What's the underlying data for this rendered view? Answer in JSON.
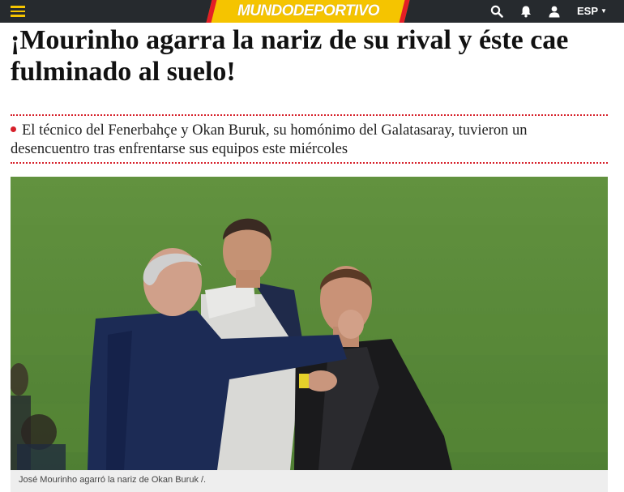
{
  "header": {
    "logo": {
      "part1": "MUNDO",
      "part2": "DEPORTIVO"
    },
    "language": "ESP",
    "icons": [
      "menu-icon",
      "search-icon",
      "bell-icon",
      "user-icon",
      "chevron-down-icon"
    ]
  },
  "article": {
    "headline": "¡Mourinho agarra la nariz de su rival y éste cae fulminado al suelo!",
    "subtitle": "El técnico del Fenerbahçe y Okan Buruk, su homónimo del Galatasaray, tuvieron un desencuentro tras enfrentarse sus equipos este miércoles",
    "photo_caption": "José Mourinho agarró la nariz de Okan Buruk /."
  },
  "colors": {
    "topbar": "#262a2e",
    "logo_yellow": "#f5c400",
    "accent_red": "#d6202a",
    "pitch_green": "#5b8a3a"
  }
}
